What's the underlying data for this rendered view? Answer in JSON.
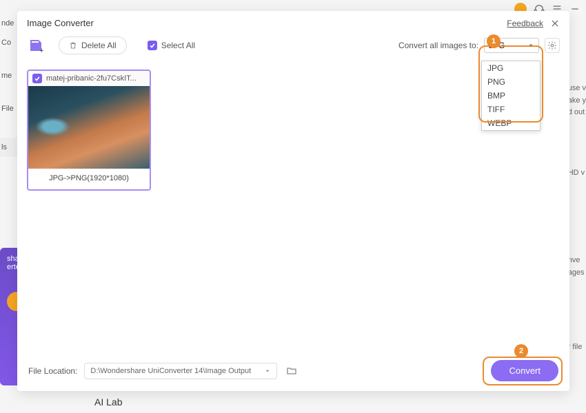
{
  "background": {
    "left_items": [
      "nde",
      "Co",
      "me",
      "File",
      "ls"
    ],
    "right_snippet1": "use v",
    "right_snippet2": "ake y",
    "right_snippet3": "d out",
    "right_hd": "HD v",
    "right_nve": "nve",
    "right_ages": "ages",
    "right_file": "r file",
    "ai_lab": "AI Lab",
    "promo1": "shar",
    "promo2": "erte"
  },
  "modal": {
    "title": "Image Converter",
    "feedback": "Feedback"
  },
  "toolbar": {
    "delete_all": "Delete All",
    "select_all": "Select All",
    "convert_label": "Convert all images to:",
    "format_selected": "JPG",
    "format_options": [
      "JPG",
      "PNG",
      "BMP",
      "TIFF",
      "WEBP"
    ]
  },
  "callouts": {
    "one": "1",
    "two": "2"
  },
  "thumb": {
    "filename": "matej-pribanic-2fu7CskIT...",
    "caption": "JPG->PNG(1920*1080)"
  },
  "footer": {
    "file_location_label": "File Location:",
    "file_location_value": "D:\\Wondershare UniConverter 14\\Image Output",
    "convert": "Convert"
  }
}
